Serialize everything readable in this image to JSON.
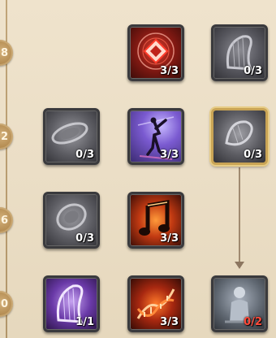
{
  "tiers": [
    {
      "label": "8"
    },
    {
      "label": "12"
    },
    {
      "label": "16"
    },
    {
      "label": "20"
    }
  ],
  "tiles": [
    {
      "icon": "crystal-rune-icon",
      "count": "3/3",
      "state": "active"
    },
    {
      "icon": "harp-icon",
      "count": "0/3",
      "state": "locked"
    },
    {
      "icon": "orbit-ring-icon",
      "count": "0/3",
      "state": "locked"
    },
    {
      "icon": "dancer-silhouette-icon",
      "count": "3/3",
      "state": "active"
    },
    {
      "icon": "harp-icon",
      "count": "0/3",
      "state": "selected"
    },
    {
      "icon": "orbit-ring-icon",
      "count": "0/3",
      "state": "locked"
    },
    {
      "icon": "music-note-icon",
      "count": "3/3",
      "state": "active"
    },
    {
      "icon": "harp-icon",
      "count": "1/1",
      "state": "active"
    },
    {
      "icon": "dna-helix-icon",
      "count": "3/3",
      "state": "active"
    },
    {
      "icon": "statue-icon",
      "count": "0/2",
      "state": "locked"
    }
  ],
  "colors": {
    "background": "#ebdec6",
    "tier_badge": "#b48c52",
    "selected_border": "#c9a455",
    "count_text": "#ffffff",
    "count_warning": "#ff4a3a",
    "connector": "#a08a70"
  }
}
